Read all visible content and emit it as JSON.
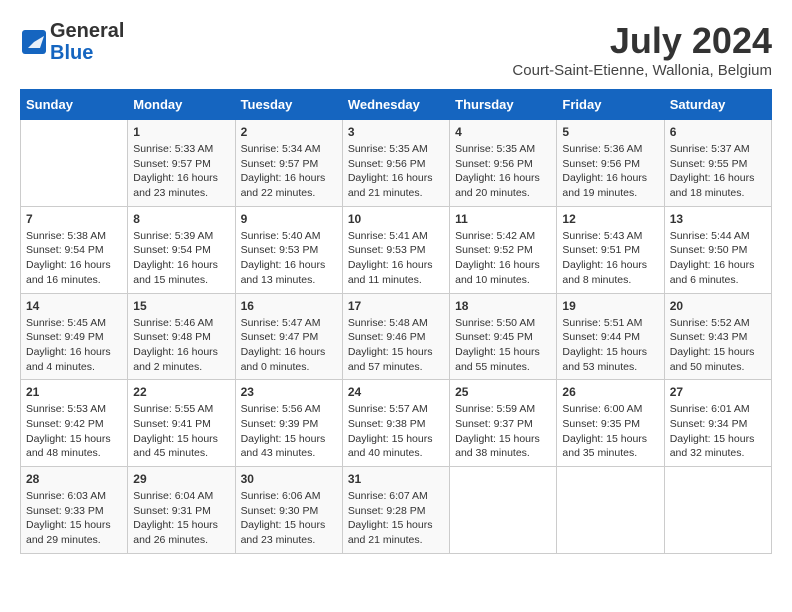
{
  "header": {
    "logo_line1": "General",
    "logo_line2": "Blue",
    "month_title": "July 2024",
    "subtitle": "Court-Saint-Etienne, Wallonia, Belgium"
  },
  "weekdays": [
    "Sunday",
    "Monday",
    "Tuesday",
    "Wednesday",
    "Thursday",
    "Friday",
    "Saturday"
  ],
  "weeks": [
    [
      {
        "day": "",
        "content": ""
      },
      {
        "day": "1",
        "content": "Sunrise: 5:33 AM\nSunset: 9:57 PM\nDaylight: 16 hours\nand 23 minutes."
      },
      {
        "day": "2",
        "content": "Sunrise: 5:34 AM\nSunset: 9:57 PM\nDaylight: 16 hours\nand 22 minutes."
      },
      {
        "day": "3",
        "content": "Sunrise: 5:35 AM\nSunset: 9:56 PM\nDaylight: 16 hours\nand 21 minutes."
      },
      {
        "day": "4",
        "content": "Sunrise: 5:35 AM\nSunset: 9:56 PM\nDaylight: 16 hours\nand 20 minutes."
      },
      {
        "day": "5",
        "content": "Sunrise: 5:36 AM\nSunset: 9:56 PM\nDaylight: 16 hours\nand 19 minutes."
      },
      {
        "day": "6",
        "content": "Sunrise: 5:37 AM\nSunset: 9:55 PM\nDaylight: 16 hours\nand 18 minutes."
      }
    ],
    [
      {
        "day": "7",
        "content": "Sunrise: 5:38 AM\nSunset: 9:54 PM\nDaylight: 16 hours\nand 16 minutes."
      },
      {
        "day": "8",
        "content": "Sunrise: 5:39 AM\nSunset: 9:54 PM\nDaylight: 16 hours\nand 15 minutes."
      },
      {
        "day": "9",
        "content": "Sunrise: 5:40 AM\nSunset: 9:53 PM\nDaylight: 16 hours\nand 13 minutes."
      },
      {
        "day": "10",
        "content": "Sunrise: 5:41 AM\nSunset: 9:53 PM\nDaylight: 16 hours\nand 11 minutes."
      },
      {
        "day": "11",
        "content": "Sunrise: 5:42 AM\nSunset: 9:52 PM\nDaylight: 16 hours\nand 10 minutes."
      },
      {
        "day": "12",
        "content": "Sunrise: 5:43 AM\nSunset: 9:51 PM\nDaylight: 16 hours\nand 8 minutes."
      },
      {
        "day": "13",
        "content": "Sunrise: 5:44 AM\nSunset: 9:50 PM\nDaylight: 16 hours\nand 6 minutes."
      }
    ],
    [
      {
        "day": "14",
        "content": "Sunrise: 5:45 AM\nSunset: 9:49 PM\nDaylight: 16 hours\nand 4 minutes."
      },
      {
        "day": "15",
        "content": "Sunrise: 5:46 AM\nSunset: 9:48 PM\nDaylight: 16 hours\nand 2 minutes."
      },
      {
        "day": "16",
        "content": "Sunrise: 5:47 AM\nSunset: 9:47 PM\nDaylight: 16 hours\nand 0 minutes."
      },
      {
        "day": "17",
        "content": "Sunrise: 5:48 AM\nSunset: 9:46 PM\nDaylight: 15 hours\nand 57 minutes."
      },
      {
        "day": "18",
        "content": "Sunrise: 5:50 AM\nSunset: 9:45 PM\nDaylight: 15 hours\nand 55 minutes."
      },
      {
        "day": "19",
        "content": "Sunrise: 5:51 AM\nSunset: 9:44 PM\nDaylight: 15 hours\nand 53 minutes."
      },
      {
        "day": "20",
        "content": "Sunrise: 5:52 AM\nSunset: 9:43 PM\nDaylight: 15 hours\nand 50 minutes."
      }
    ],
    [
      {
        "day": "21",
        "content": "Sunrise: 5:53 AM\nSunset: 9:42 PM\nDaylight: 15 hours\nand 48 minutes."
      },
      {
        "day": "22",
        "content": "Sunrise: 5:55 AM\nSunset: 9:41 PM\nDaylight: 15 hours\nand 45 minutes."
      },
      {
        "day": "23",
        "content": "Sunrise: 5:56 AM\nSunset: 9:39 PM\nDaylight: 15 hours\nand 43 minutes."
      },
      {
        "day": "24",
        "content": "Sunrise: 5:57 AM\nSunset: 9:38 PM\nDaylight: 15 hours\nand 40 minutes."
      },
      {
        "day": "25",
        "content": "Sunrise: 5:59 AM\nSunset: 9:37 PM\nDaylight: 15 hours\nand 38 minutes."
      },
      {
        "day": "26",
        "content": "Sunrise: 6:00 AM\nSunset: 9:35 PM\nDaylight: 15 hours\nand 35 minutes."
      },
      {
        "day": "27",
        "content": "Sunrise: 6:01 AM\nSunset: 9:34 PM\nDaylight: 15 hours\nand 32 minutes."
      }
    ],
    [
      {
        "day": "28",
        "content": "Sunrise: 6:03 AM\nSunset: 9:33 PM\nDaylight: 15 hours\nand 29 minutes."
      },
      {
        "day": "29",
        "content": "Sunrise: 6:04 AM\nSunset: 9:31 PM\nDaylight: 15 hours\nand 26 minutes."
      },
      {
        "day": "30",
        "content": "Sunrise: 6:06 AM\nSunset: 9:30 PM\nDaylight: 15 hours\nand 23 minutes."
      },
      {
        "day": "31",
        "content": "Sunrise: 6:07 AM\nSunset: 9:28 PM\nDaylight: 15 hours\nand 21 minutes."
      },
      {
        "day": "",
        "content": ""
      },
      {
        "day": "",
        "content": ""
      },
      {
        "day": "",
        "content": ""
      }
    ]
  ]
}
